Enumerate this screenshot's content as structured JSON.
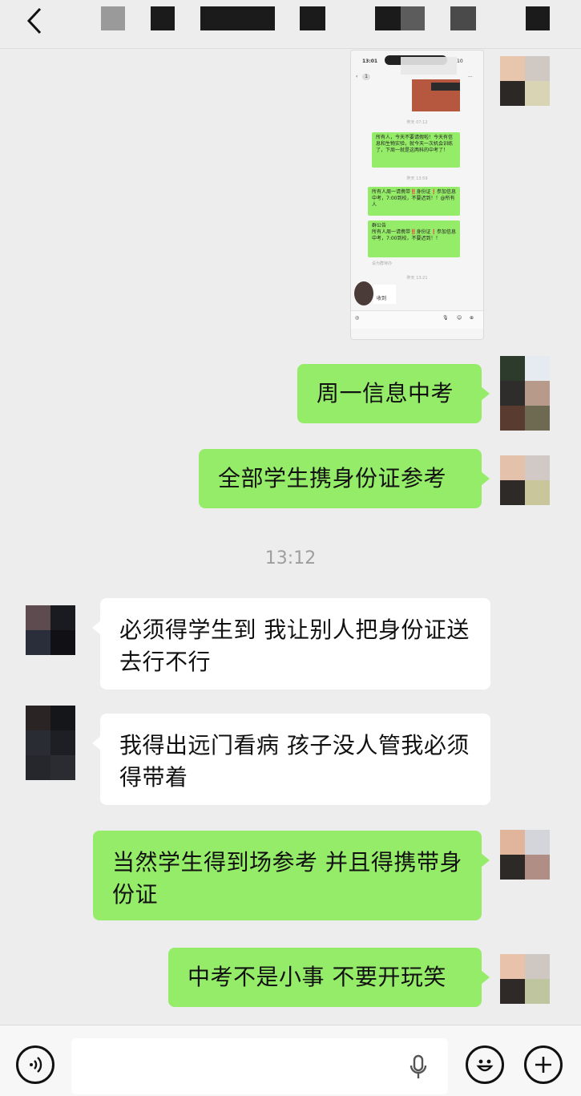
{
  "header": {
    "back_icon": "chevron-left-icon"
  },
  "screenshot": {
    "time": "13:01",
    "battery": "10",
    "badge": "1",
    "more": "...",
    "ts1": "昨天 07:12",
    "msg1": "所有人，今天不要请假啦！今天有信息和生物实验，就今天一次机会训练了，下周一就是这两科的中考了！",
    "ts2": "昨天 13:59",
    "msg2": "所有人周一请携带‼️身份证❗参加信息中考，7:00到校，不要迟到！！@所有人",
    "msg3": "群公告\n所有人周一请携带‼️身份证❗参加信息中考，7:00到校，不要迟到！！",
    "msg3_tag": "设为群待办",
    "ts3": "昨天 13:21",
    "received": "收到"
  },
  "messages": [
    {
      "side": "me",
      "text": "周一信息中考"
    },
    {
      "side": "me",
      "text": "全部学生携身份证参考"
    },
    {
      "side": "other",
      "text": "必须得学生到  我让别人把身份证送去行不行"
    },
    {
      "side": "other",
      "text": "我得出远门看病  孩子没人管我必须得带着"
    },
    {
      "side": "me",
      "text": "当然学生得到场参考 并且得携带身份证"
    },
    {
      "side": "me",
      "text": "中考不是小事 不要开玩笑"
    }
  ],
  "timestamp": "13:12",
  "bottom": {
    "voice_icon": "voice-icon",
    "mic_icon": "mic-icon",
    "emoji_icon": "emoji-icon",
    "plus_icon": "plus-icon"
  },
  "colors": {
    "bubble_me": "#95ec69",
    "bubble_other": "#ffffff",
    "background": "#ededed"
  }
}
